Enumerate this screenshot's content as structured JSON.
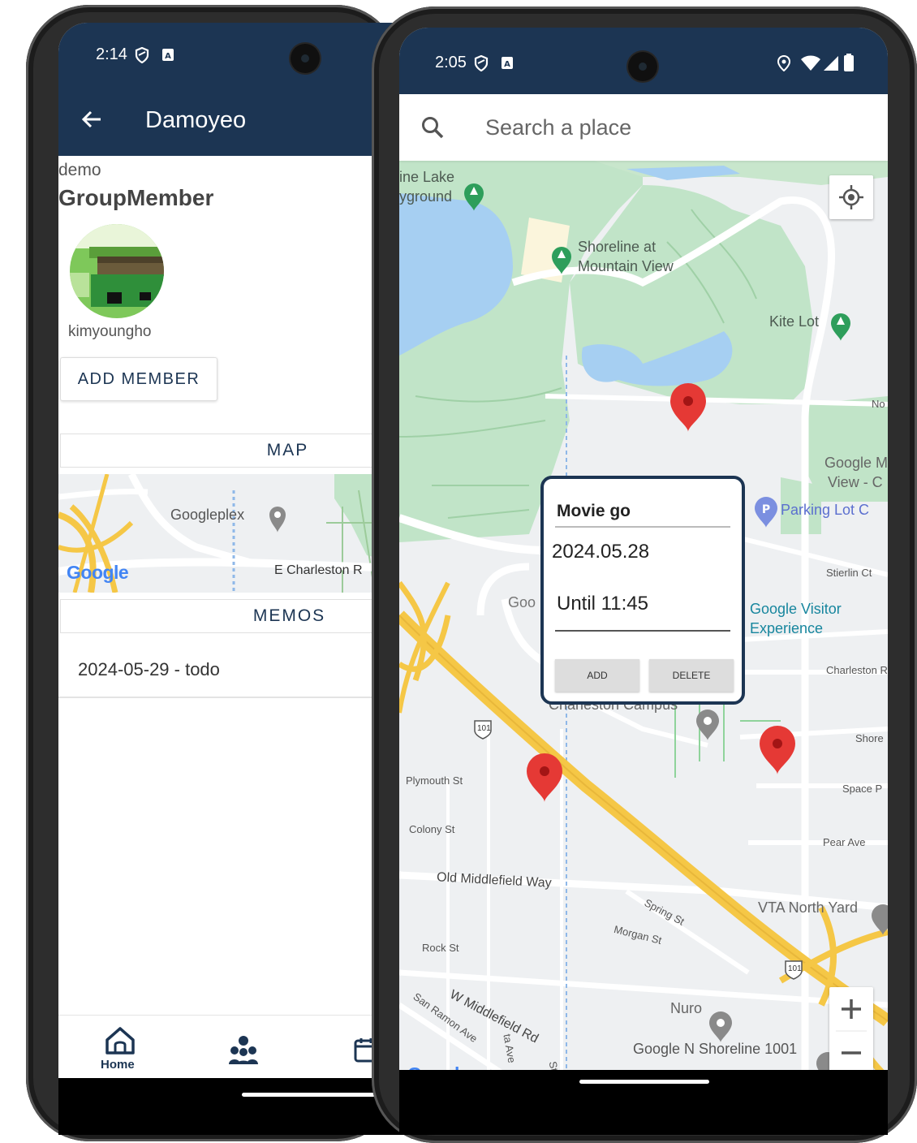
{
  "left_phone": {
    "status": {
      "time": "2:14"
    },
    "appbar": {
      "title": "Damoyeo"
    },
    "group": {
      "label": "demo",
      "title": "GroupMember"
    },
    "member": {
      "username": "kimyoungho"
    },
    "add_member_label": "ADD MEMBER",
    "map_section_label": "MAP",
    "mini_map": {
      "labels": [
        "Googleplex",
        "E Charleston R"
      ],
      "logo": "Google"
    },
    "memos_section_label": "MEMOS",
    "memos": [
      {
        "text": "2024-05-29 - todo"
      }
    ],
    "bottom_nav": {
      "home_label": "Home"
    }
  },
  "right_phone": {
    "status": {
      "time": "2:05"
    },
    "search": {
      "placeholder": "Search a place"
    },
    "map": {
      "labels": {
        "lake": "ine Lake",
        "playground": "yground",
        "shoreline_1": "Shoreline at",
        "shoreline_2": "Mountain View",
        "kite_lot": "Kite Lot",
        "no": "No",
        "google_mv_1": "Google M",
        "google_mv_2": "View - C",
        "parking": "Parking Lot C",
        "stierlin": "Stierlin Ct",
        "goo": "Goo",
        "visitor_1": "Google Visitor",
        "visitor_2": "Experience",
        "charleston_rd": "Charleston R",
        "charleston_campus": "Charleston Campus",
        "shore": "Shore",
        "space": "Space P",
        "plymouth": "Plymouth St",
        "colony": "Colony St",
        "pear": "Pear Ave",
        "old_middlefield": "Old Middlefield Way",
        "vta": "VTA North Yard",
        "spring": "Spring St",
        "morgan": "Morgan St",
        "rock": "Rock St",
        "w_middlefield": "W Middlefield Rd",
        "san_ramon": "San Ramon Ave",
        "nuro": "Nuro",
        "google_n_shoreline": "Google N Shoreline 1001",
        "hwy_101_a": "101",
        "hwy_101_b": "101",
        "ave": "ta Ave",
        "st": "St"
      },
      "logo": "Google"
    },
    "popup": {
      "title": "Movie go",
      "date": "2024.05.28",
      "until": "Until 11:45",
      "add_label": "ADD",
      "delete_label": "DELETE"
    }
  },
  "colors": {
    "primary": "#1c3553",
    "park": "#c1e4c8",
    "water": "#a6cff2",
    "highway": "#f5c746",
    "marker": "#e53935",
    "poi_green": "#2e9e5b"
  }
}
